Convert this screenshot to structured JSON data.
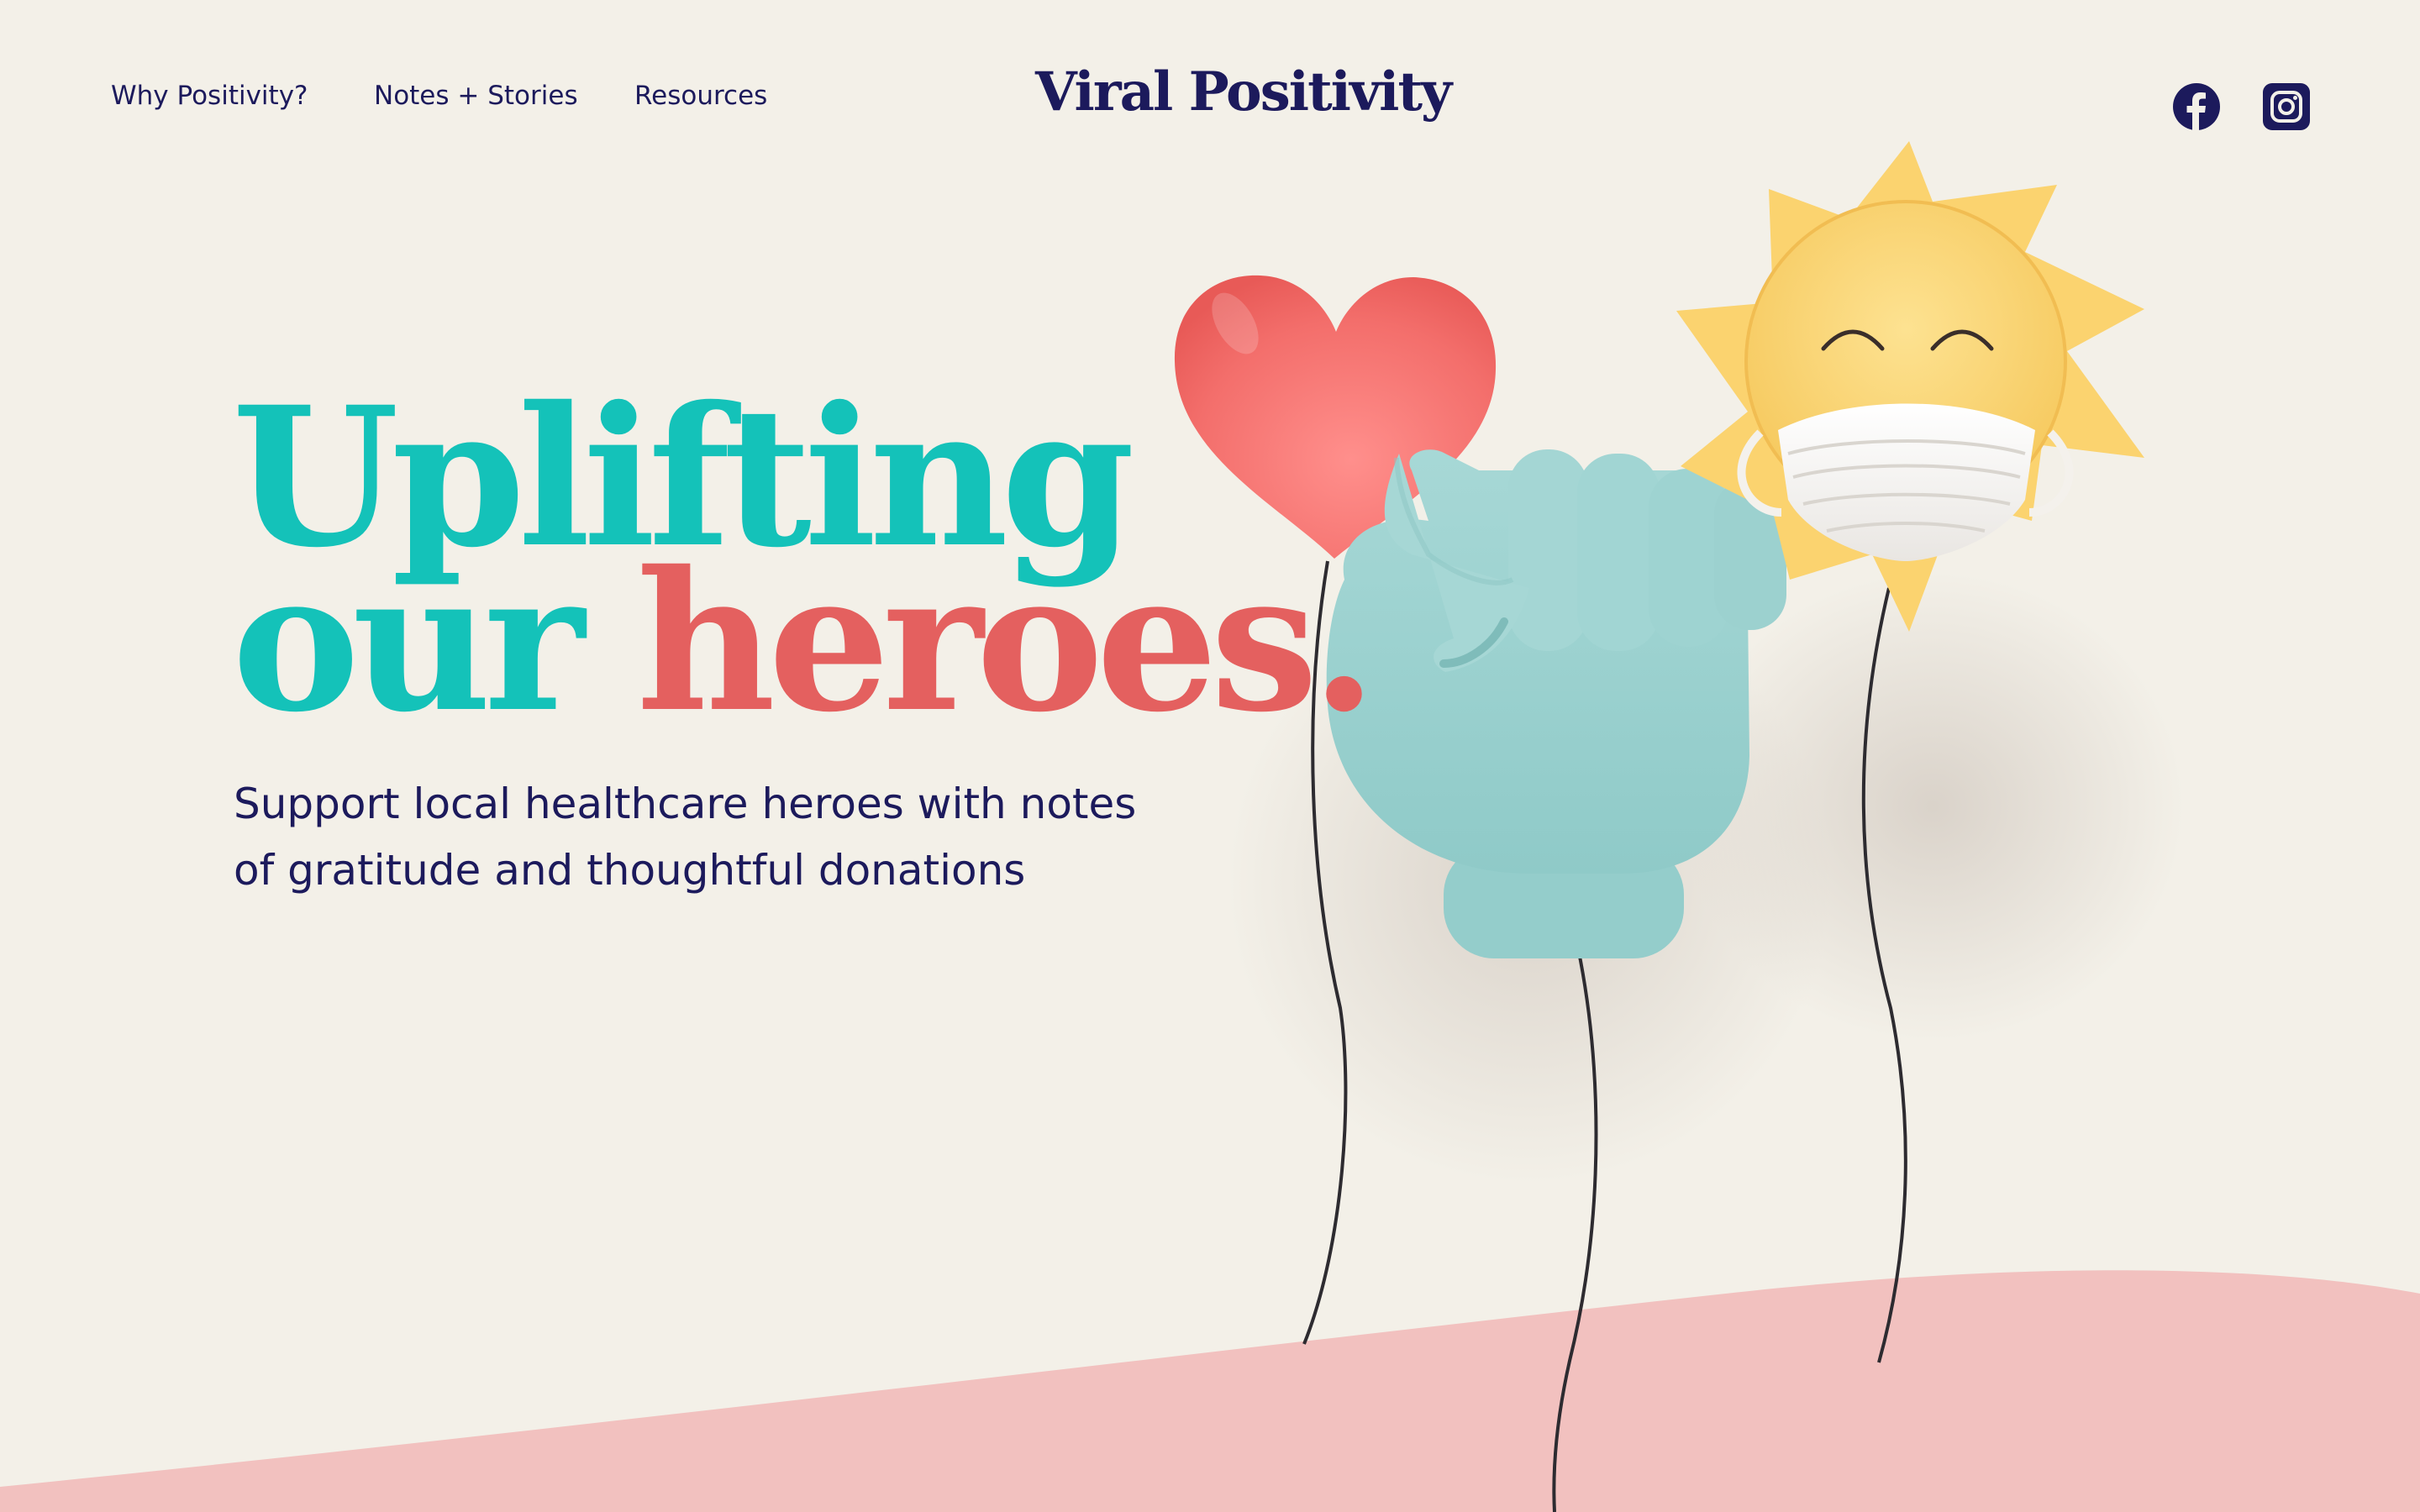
{
  "nav": {
    "items": [
      {
        "label": "Why Positivity?"
      },
      {
        "label": "Notes + Stories"
      },
      {
        "label": "Resources"
      }
    ]
  },
  "brand": {
    "logo_text": "Viral Positivity"
  },
  "social": {
    "icons": [
      "facebook-icon",
      "instagram-icon"
    ]
  },
  "hero": {
    "headline_line1": "Uplifting",
    "headline_line2_part1": "our ",
    "headline_line2_part2": "heroes.",
    "subtext": "Support local healthcare heroes with notes of gratitude and thoughtful donations"
  },
  "illustrations": [
    "heart-balloon",
    "fist-balloon",
    "masked-sun-balloon"
  ],
  "colors": {
    "background": "#f3f0e8",
    "navy": "#1c1a5c",
    "teal": "#14c2b9",
    "coral": "#e4605f",
    "pink_hill": "#f2c1bf",
    "fist": "#9fd3d1",
    "sun": "#fbd36f",
    "heart": "#f46e6c"
  }
}
